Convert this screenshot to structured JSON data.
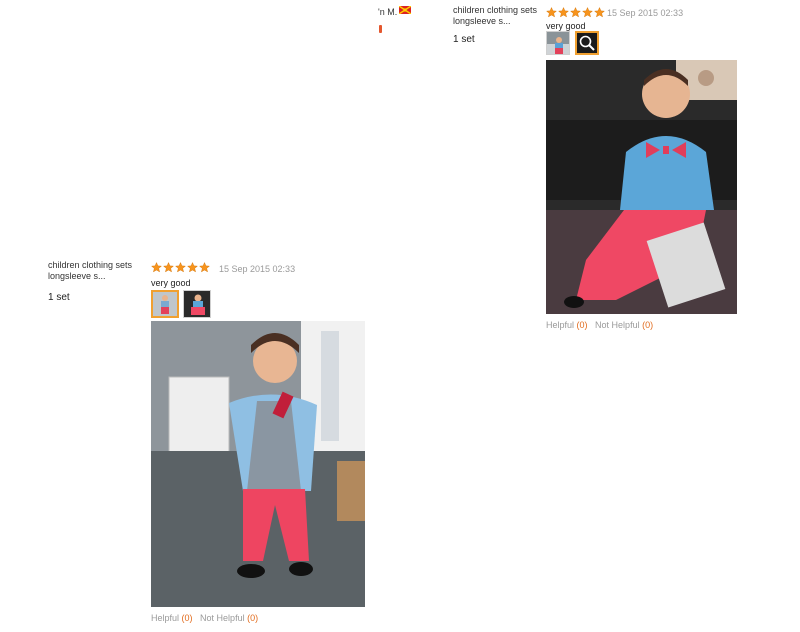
{
  "top_stub": {
    "name_fragment": "'n M.",
    "country_flag_icon": "flag-icon"
  },
  "reviews": [
    {
      "product": "children clothing sets longsleeve s...",
      "quantity": "1 set",
      "rating": 5,
      "date": "15 Sep 2015 02:33",
      "comment": "very good",
      "helpful_label": "Helpful",
      "helpful_count": "(0)",
      "not_helpful_label": "Not Helpful",
      "not_helpful_count": "(0)",
      "photo_icon": "magnifier-icon"
    },
    {
      "product": "children clothing sets longsleeve s...",
      "quantity": "1 set",
      "rating": 5,
      "date": "15 Sep 2015 02:33",
      "comment": "very good",
      "helpful_label": "Helpful",
      "helpful_count": "(0)",
      "not_helpful_label": "Not Helpful",
      "not_helpful_count": "(0)"
    }
  ],
  "colors": {
    "star": "#f7941d",
    "count": "#e26c1e",
    "muted": "#9a9a9a"
  }
}
